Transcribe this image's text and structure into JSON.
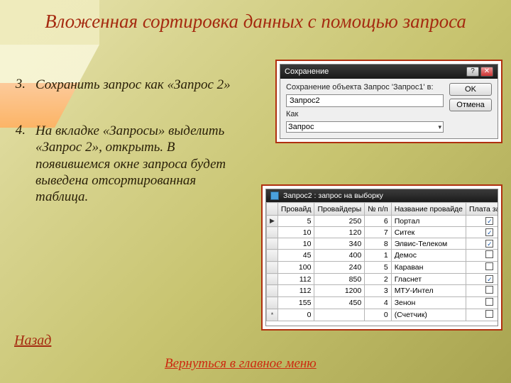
{
  "title": "Вложенная сортировка данных с помощью запроса",
  "steps": [
    {
      "num": "3.",
      "text": "Сохранить запрос как «Запрос 2»"
    },
    {
      "num": "4.",
      "text": "На вкладке «Запросы» выделить «Запрос 2», открыть. В появившемся окне запроса будет выведена отсортированная таблица."
    }
  ],
  "nav": {
    "back": "Назад",
    "main_menu": "Вернуться в главное меню"
  },
  "save_dialog": {
    "window_title": "Сохранение",
    "prompt": "Сохранение объекта Запрос 'Запрос1' в:",
    "name_value": "Запрос2",
    "type_label": "Как",
    "type_value": "Запрос",
    "ok": "OK",
    "cancel": "Отмена",
    "help_glyph": "?",
    "close_glyph": "✕"
  },
  "query_window": {
    "title": "Запрос2 : запрос на выборку",
    "columns": [
      "Провайд",
      "Провайдеры",
      "№ п/п",
      "Название провайде",
      "Плата за по"
    ],
    "rows": [
      {
        "marker": "▶",
        "c1": "5",
        "c2": "250",
        "c3": "6",
        "c4": "Портал",
        "chk": true
      },
      {
        "marker": "",
        "c1": "10",
        "c2": "120",
        "c3": "7",
        "c4": "Ситек",
        "chk": true
      },
      {
        "marker": "",
        "c1": "10",
        "c2": "340",
        "c3": "8",
        "c4": "Элвис-Телеком",
        "chk": true
      },
      {
        "marker": "",
        "c1": "45",
        "c2": "400",
        "c3": "1",
        "c4": "Демос",
        "chk": false
      },
      {
        "marker": "",
        "c1": "100",
        "c2": "240",
        "c3": "5",
        "c4": "Караван",
        "chk": false
      },
      {
        "marker": "",
        "c1": "112",
        "c2": "850",
        "c3": "2",
        "c4": "Гласнет",
        "chk": true
      },
      {
        "marker": "",
        "c1": "112",
        "c2": "1200",
        "c3": "3",
        "c4": "МТУ-Интел",
        "chk": false
      },
      {
        "marker": "",
        "c1": "155",
        "c2": "450",
        "c3": "4",
        "c4": "Зенон",
        "chk": false
      },
      {
        "marker": "*",
        "c1": "0",
        "c2": "",
        "c3": "0",
        "c4": "(Счетчик)",
        "chk": false
      }
    ]
  }
}
